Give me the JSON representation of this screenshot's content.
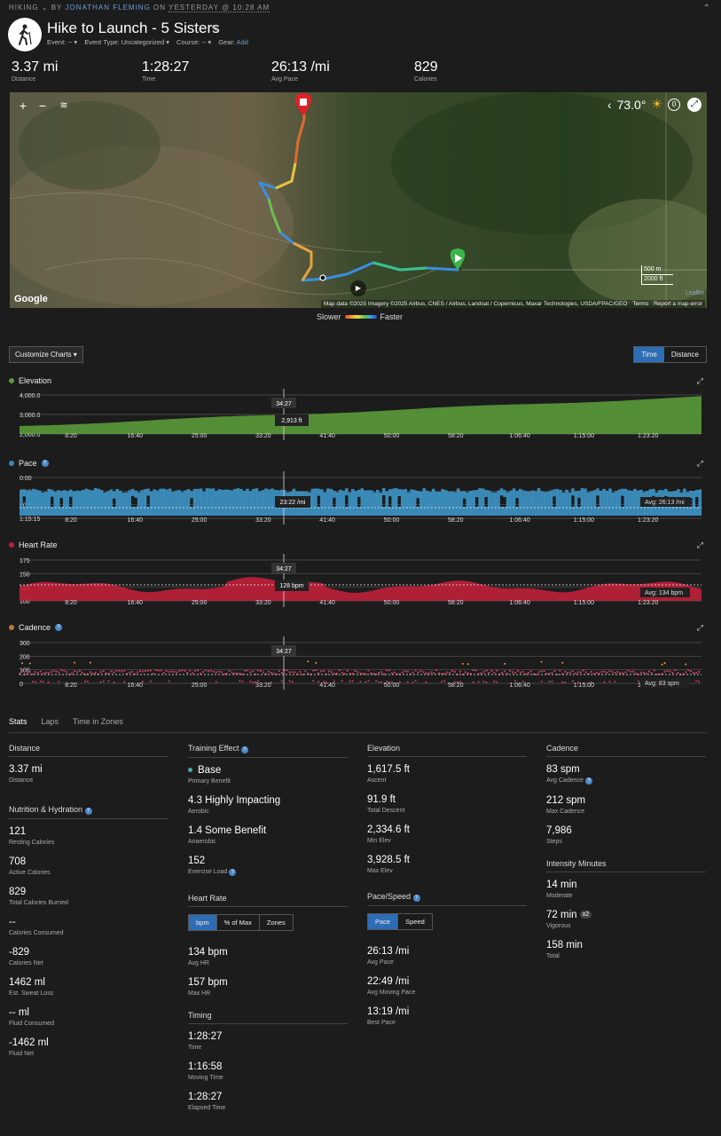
{
  "header": {
    "category": "HIKING",
    "by": "BY",
    "author": "JONATHAN FLEMING",
    "on": "ON",
    "when": "YESTERDAY @ 10:28 AM",
    "title": "Hike to Launch - 5 Sisters",
    "event": "Event: --",
    "event_type": "Event Type: Uncategorized",
    "course": "Course: --",
    "gear_label": "Gear:",
    "gear_add": "Add"
  },
  "summary": [
    {
      "value": "3.37 mi",
      "label": "Distance"
    },
    {
      "value": "1:28:27",
      "label": "Time"
    },
    {
      "value": "26:13 /mi",
      "label": "Avg Pace"
    },
    {
      "value": "829",
      "label": "Calories"
    }
  ],
  "map": {
    "temperature": "73.0°",
    "wind": "0",
    "scale_m": "500 m",
    "scale_ft": "2000 ft",
    "leaflet": "Leaflet",
    "google": "Google",
    "attribution": "Map data ©2025 Imagery ©2025 Airbus, CNES / Airbus, Landsat / Copernicus, Maxar Technologies, USDA/FPAC/GEO",
    "terms": "Terms",
    "report": "Report a map error",
    "legend_slow": "Slower",
    "legend_fast": "Faster"
  },
  "controls": {
    "customize": "Customize Charts",
    "time": "Time",
    "distance": "Distance"
  },
  "charts": {
    "x_ticks": [
      "8:20",
      "16:40",
      "25:00",
      "33:20",
      "41:40",
      "50:00",
      "58:20",
      "1:06:40",
      "1:15:00",
      "1:23:20"
    ],
    "cursor_time": "34:27",
    "elevation": {
      "title": "Elevation",
      "y_ticks": [
        "4,000.0",
        "3,000.0",
        "2,000.0"
      ],
      "tooltip": "2,913 ft",
      "color": "#5a9a3a"
    },
    "pace": {
      "title": "Pace",
      "y_ticks": [
        "0:00",
        "25:00",
        "50:00",
        "1:15:15"
      ],
      "tooltip": "23:22 /mi",
      "avg": "Avg: 26:13 /mi",
      "color": "#3a8ab8"
    },
    "heart_rate": {
      "title": "Heart Rate",
      "y_ticks": [
        "175",
        "150",
        "125",
        "100"
      ],
      "tooltip": "128 bpm",
      "avg": "Avg: 134 bpm",
      "color": "#c0203a"
    },
    "cadence": {
      "title": "Cadence",
      "y_ticks": [
        "300",
        "200",
        "100",
        "0"
      ],
      "avg": "Avg: 83 spm",
      "color": "#c84060"
    }
  },
  "tabs": [
    "Stats",
    "Laps",
    "Time in Zones"
  ],
  "stats": {
    "distance": {
      "heading": "Distance",
      "items": [
        {
          "v": "3.37 mi",
          "l": "Distance"
        }
      ]
    },
    "nutrition": {
      "heading": "Nutrition & Hydration",
      "items": [
        {
          "v": "121",
          "l": "Resting Calories"
        },
        {
          "v": "708",
          "l": "Active Calories"
        },
        {
          "v": "829",
          "l": "Total Calories Burned"
        },
        {
          "v": "--",
          "l": "Calories Consumed"
        },
        {
          "v": "-829",
          "l": "Calories Net"
        },
        {
          "v": "1462 ml",
          "l": "Est. Sweat Loss"
        },
        {
          "v": "-- ml",
          "l": "Fluid Consumed"
        },
        {
          "v": "-1462 ml",
          "l": "Fluid Net"
        }
      ]
    },
    "training": {
      "heading": "Training Effect",
      "items": [
        {
          "v": "Base",
          "l": "Primary Benefit"
        },
        {
          "v": "4.3 Highly Impacting",
          "l": "Aerobic"
        },
        {
          "v": "1.4 Some Benefit",
          "l": "Anaerobic"
        },
        {
          "v": "152",
          "l": "Exercise Load"
        }
      ]
    },
    "heart": {
      "heading": "Heart Rate",
      "seg": [
        "bpm",
        "% of Max",
        "Zones"
      ],
      "items": [
        {
          "v": "134 bpm",
          "l": "Avg HR"
        },
        {
          "v": "157 bpm",
          "l": "Max HR"
        }
      ]
    },
    "timing": {
      "heading": "Timing",
      "items": [
        {
          "v": "1:28:27",
          "l": "Time"
        },
        {
          "v": "1:16:58",
          "l": "Moving Time"
        },
        {
          "v": "1:28:27",
          "l": "Elapsed Time"
        }
      ]
    },
    "elevation": {
      "heading": "Elevation",
      "items": [
        {
          "v": "1,617.5 ft",
          "l": "Ascent"
        },
        {
          "v": "91.9 ft",
          "l": "Total Descent"
        },
        {
          "v": "2,334.6 ft",
          "l": "Min Elev"
        },
        {
          "v": "3,928.5 ft",
          "l": "Max Elev"
        }
      ]
    },
    "pace": {
      "heading": "Pace/Speed",
      "seg": [
        "Pace",
        "Speed"
      ],
      "items": [
        {
          "v": "26:13 /mi",
          "l": "Avg Pace"
        },
        {
          "v": "22:49 /mi",
          "l": "Avg Moving Pace"
        },
        {
          "v": "13:19 /mi",
          "l": "Best Pace"
        }
      ]
    },
    "cadence": {
      "heading": "Cadence",
      "items": [
        {
          "v": "83 spm",
          "l": "Avg Cadence"
        },
        {
          "v": "212 spm",
          "l": "Max Cadence"
        },
        {
          "v": "7,986",
          "l": "Steps"
        }
      ]
    },
    "intensity": {
      "heading": "Intensity Minutes",
      "badge": "x2",
      "items": [
        {
          "v": "14 min",
          "l": "Moderate"
        },
        {
          "v": "72 min",
          "l": "Vigorous"
        },
        {
          "v": "158 min",
          "l": "Total"
        }
      ]
    }
  }
}
